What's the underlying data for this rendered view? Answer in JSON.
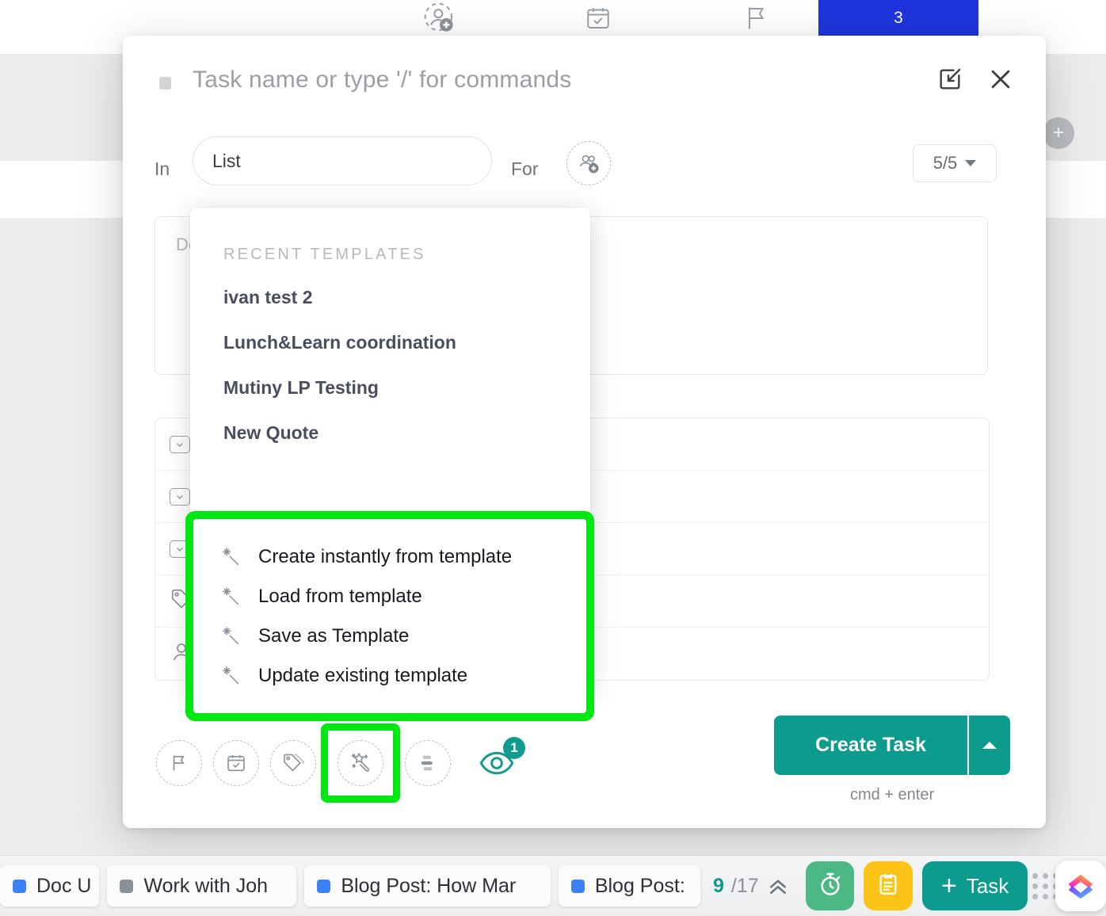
{
  "background": {
    "top_icons": [
      "add-assignee-icon",
      "due-date-icon",
      "priority-flag-icon"
    ],
    "blue_tile_label": "3",
    "add_button_label": "+"
  },
  "modal": {
    "header": {
      "title_placeholder": "Task name or type '/' for commands",
      "expand_label": "expand-icon",
      "close_label": "close-icon"
    },
    "meta": {
      "in_label": "In",
      "list_value": "List",
      "for_label": "For",
      "assignee_icon": "add-assignees-icon",
      "subtask_count": "5/5"
    },
    "body": {
      "description_placeholder": "Description"
    },
    "template_dropdown": {
      "section_title": "RECENT TEMPLATES",
      "recent": [
        "ivan test 2",
        "Lunch&Learn coordination",
        "Mutiny LP Testing",
        "New Quote"
      ],
      "actions": [
        "Create instantly from template",
        "Load from template",
        "Save as Template",
        "Update existing template"
      ]
    },
    "footer": {
      "icons": [
        "priority-flag-icon",
        "due-date-icon",
        "tags-icon",
        "templates-wand-icon",
        "custom-fields-icon"
      ],
      "watchers_icon": "eye-icon",
      "watchers_count": "1",
      "create_label": "Create Task",
      "create_caret": "caret-up-icon",
      "create_hint": "cmd + enter"
    }
  },
  "taskbar": {
    "chips": [
      {
        "label": "Doc U",
        "color": "#3b82f6"
      },
      {
        "label": "Work with Joh",
        "color": "#8b9096"
      },
      {
        "label": "Blog Post: How Mar",
        "color": "#3b82f6"
      },
      {
        "label": "Blog Post:",
        "color": "#3b82f6"
      }
    ],
    "counter_current": "9",
    "counter_total": "/17",
    "timer_icon": "stopwatch-icon",
    "form_icon": "clipboard-icon",
    "new_task_label": "Task",
    "new_task_plus": "+",
    "logo": "clickup-logo"
  },
  "colors": {
    "highlight_green": "#00e812",
    "brand_teal": "#0c9b8d",
    "blue_tile": "#1f35dd"
  }
}
